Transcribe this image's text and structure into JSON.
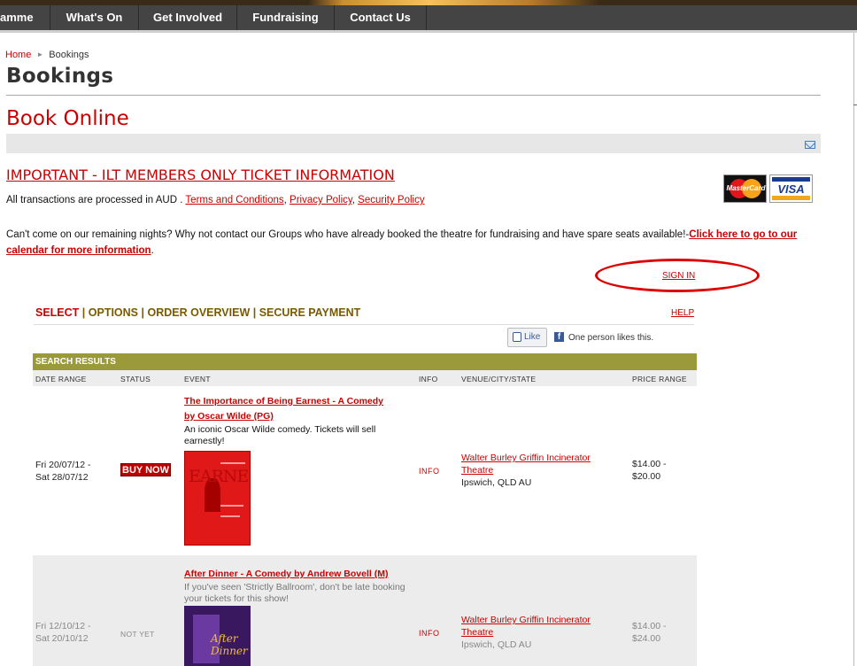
{
  "nav": {
    "items": [
      "amme",
      "What's On",
      "Get Involved",
      "Fundraising",
      "Contact Us"
    ]
  },
  "breadcrumb": {
    "home": "Home",
    "current": "Bookings"
  },
  "page": {
    "title": "Bookings",
    "book_online": "Book Online",
    "important_link": "IMPORTANT - ILT MEMBERS ONLY TICKET INFORMATION",
    "transactions_text": "All transactions are processed in AUD . ",
    "terms": "Terms and Conditions",
    "privacy": "Privacy Policy",
    "security": "Security Policy",
    "cantcome_text": "Can't come on our remaining nights? Why not contact our Groups who have already booked the theatre for fundraising and have spare seats available!-",
    "cantcome_link": "Click here to go to our calendar for more information",
    "signin": "SIGN IN"
  },
  "cards": {
    "mastercard": "MasterCard",
    "visa": "VISA"
  },
  "steps": {
    "select": "SELECT",
    "options": "OPTIONS",
    "order": "ORDER OVERVIEW",
    "payment": "SECURE PAYMENT",
    "help": "HELP"
  },
  "social": {
    "like": "Like",
    "like_text": "One person likes this."
  },
  "results": {
    "header": "SEARCH RESULTS",
    "columns": [
      "DATE RANGE",
      "STATUS",
      "EVENT",
      "INFO",
      "VENUE/CITY/STATE",
      "PRICE RANGE"
    ],
    "rows": [
      {
        "date_from": "Fri 20/07/12 -",
        "date_to": "Sat 28/07/12",
        "status": "BUY NOW",
        "title_line1": "The Importance of Being Earnest - A Comedy",
        "title_line2": "by Oscar Wilde (PG)",
        "desc_line1": "An iconic Oscar Wilde comedy. Tickets will sell",
        "desc_line2": "earnestly!",
        "info": "INFO",
        "venue_line1": "Walter Burley Griffin Incinerator",
        "venue_line2": "Theatre",
        "city": "Ipswich, QLD AU",
        "price_from": "$14.00 -",
        "price_to": "$20.00",
        "poster_word": "EARNEST"
      },
      {
        "date_from": "Fri 12/10/12 -",
        "date_to": "Sat 20/10/12",
        "status": "NOT YET",
        "title_line1": "After Dinner - A Comedy by Andrew Bovell (M)",
        "desc_line1": "If you've seen 'Strictly Ballroom', don't be late booking",
        "desc_line2": "your tickets for this show!",
        "info": "INFO",
        "venue_line1": "Walter Burley Griffin Incinerator",
        "venue_line2": "Theatre",
        "city": "Ipswich, QLD AU",
        "price_from": "$14.00 -",
        "price_to": "$24.00",
        "poster_word": "After Dinner"
      }
    ]
  }
}
